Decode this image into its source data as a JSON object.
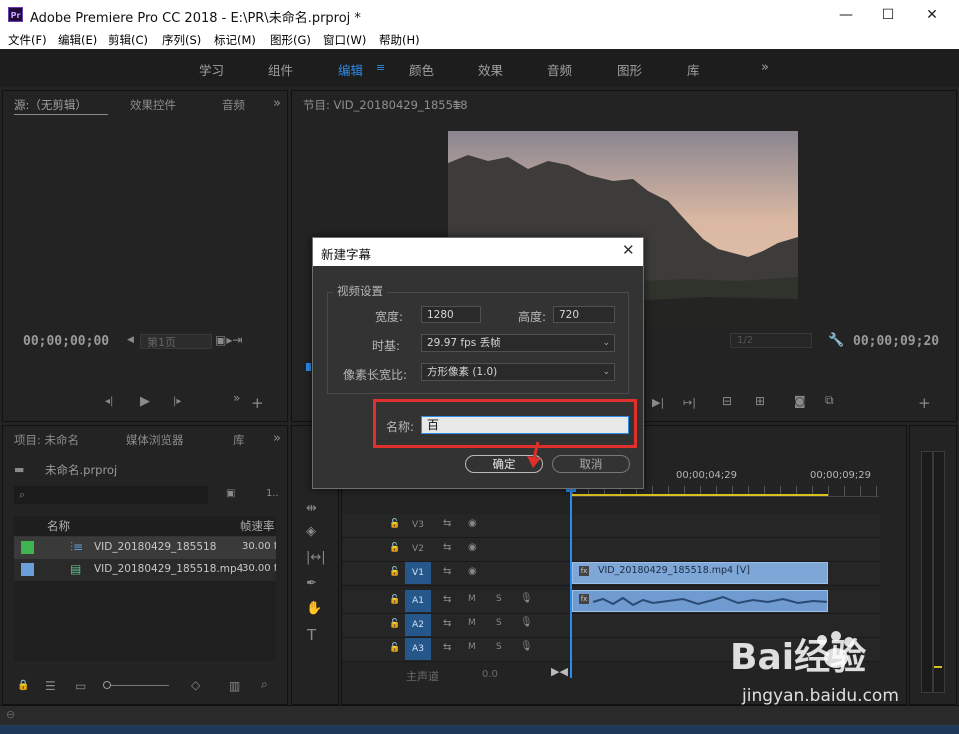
{
  "window": {
    "app_icon": "Pr",
    "title": "Adobe Premiere Pro CC 2018 - E:\\PR\\未命名.prproj *",
    "min": "—",
    "max": "☐",
    "close": "✕"
  },
  "menu": [
    "文件(F)",
    "编辑(E)",
    "剪辑(C)",
    "序列(S)",
    "标记(M)",
    "图形(G)",
    "窗口(W)",
    "帮助(H)"
  ],
  "workspaces": {
    "items": [
      "学习",
      "组件",
      "编辑",
      "颜色",
      "效果",
      "音频",
      "图形",
      "库"
    ],
    "active": "编辑",
    "overflow": "»"
  },
  "source_panel": {
    "tabs": [
      "源:（无剪辑）",
      "效果控件",
      "音频"
    ],
    "overflow": "»",
    "timecode": "00;00;00;00",
    "page": "第1页"
  },
  "program_panel": {
    "title": "节目: VID_20180429_185518",
    "menu_glyph": "≡",
    "zoom": "1/2",
    "timecode": "00;00;09;20"
  },
  "project_panel": {
    "tabs": [
      "项目: 未命名",
      "媒体浏览器",
      "库"
    ],
    "overflow": "»",
    "project_file": "未命名.prproj",
    "count": "1..",
    "columns": [
      "名称",
      "帧速率"
    ],
    "items": [
      {
        "name": "VID_20180429_185518",
        "fps": "30.00 f",
        "color": "#3fb34f"
      },
      {
        "name": "VID_20180429_185518.mp4",
        "fps": "30.00 f",
        "color": "#6a9fd9"
      }
    ]
  },
  "timeline": {
    "ruler": [
      "00;00;04;29",
      "00;00;09;29"
    ],
    "tracks": [
      "V3",
      "V2",
      "V1",
      "A1",
      "A2",
      "A3"
    ],
    "master": "主声道",
    "master_value": "0.0",
    "clip_video": "VID_20180429_185518.mp4 [V]",
    "clip_badge": "fx"
  },
  "dialog": {
    "title": "新建字幕",
    "group": "视频设置",
    "width_label": "宽度:",
    "width_value": "1280",
    "height_label": "高度:",
    "height_value": "720",
    "timebase_label": "时基:",
    "timebase_value": "29.97 fps 丢帧",
    "pixel_label": "像素长宽比:",
    "pixel_value": "方形像素 (1.0)",
    "name_label": "名称:",
    "name_value": "百",
    "ok": "确定",
    "cancel": "取消"
  },
  "watermark": {
    "brand": "Bai经验",
    "url": "jingyan.baidu.com"
  },
  "colors": {
    "accent": "#2d8ceb",
    "highlight_box": "#e0302b",
    "clip_video": "#7ea6d6",
    "clip_audio": "#6f9bd1"
  }
}
